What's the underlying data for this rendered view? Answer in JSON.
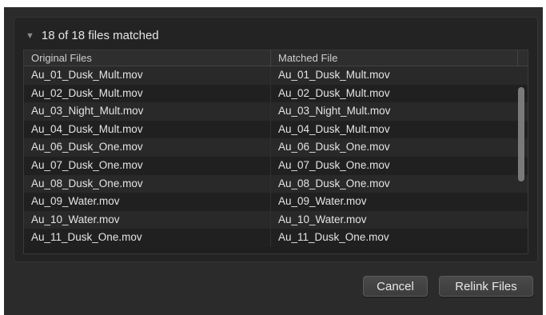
{
  "header": {
    "summary": "18 of 18 files matched",
    "disclosure_glyph": "▼"
  },
  "table": {
    "columns": [
      "Original Files",
      "Matched File",
      ""
    ],
    "rows": [
      {
        "original": "Au_01_Dusk_Mult.mov",
        "matched": "Au_01_Dusk_Mult.mov"
      },
      {
        "original": "Au_02_Dusk_Mult.mov",
        "matched": "Au_02_Dusk_Mult.mov"
      },
      {
        "original": "Au_03_Night_Mult.mov",
        "matched": "Au_03_Night_Mult.mov"
      },
      {
        "original": "Au_04_Dusk_Mult.mov",
        "matched": "Au_04_Dusk_Mult.mov"
      },
      {
        "original": "Au_06_Dusk_One.mov",
        "matched": "Au_06_Dusk_One.mov"
      },
      {
        "original": "Au_07_Dusk_One.mov",
        "matched": "Au_07_Dusk_One.mov"
      },
      {
        "original": "Au_08_Dusk_One.mov",
        "matched": "Au_08_Dusk_One.mov"
      },
      {
        "original": "Au_09_Water.mov",
        "matched": "Au_09_Water.mov"
      },
      {
        "original": "Au_10_Water.mov",
        "matched": "Au_10_Water.mov"
      },
      {
        "original": "Au_11_Dusk_One.mov",
        "matched": "Au_11_Dusk_One.mov"
      }
    ]
  },
  "buttons": {
    "cancel_label": "Cancel",
    "relink_label": "Relink Files"
  },
  "colors": {
    "dialog_bg": "#2b2b2c",
    "row_alt": "#29292a",
    "row_base": "#202021",
    "text": "#e4e4e4"
  }
}
